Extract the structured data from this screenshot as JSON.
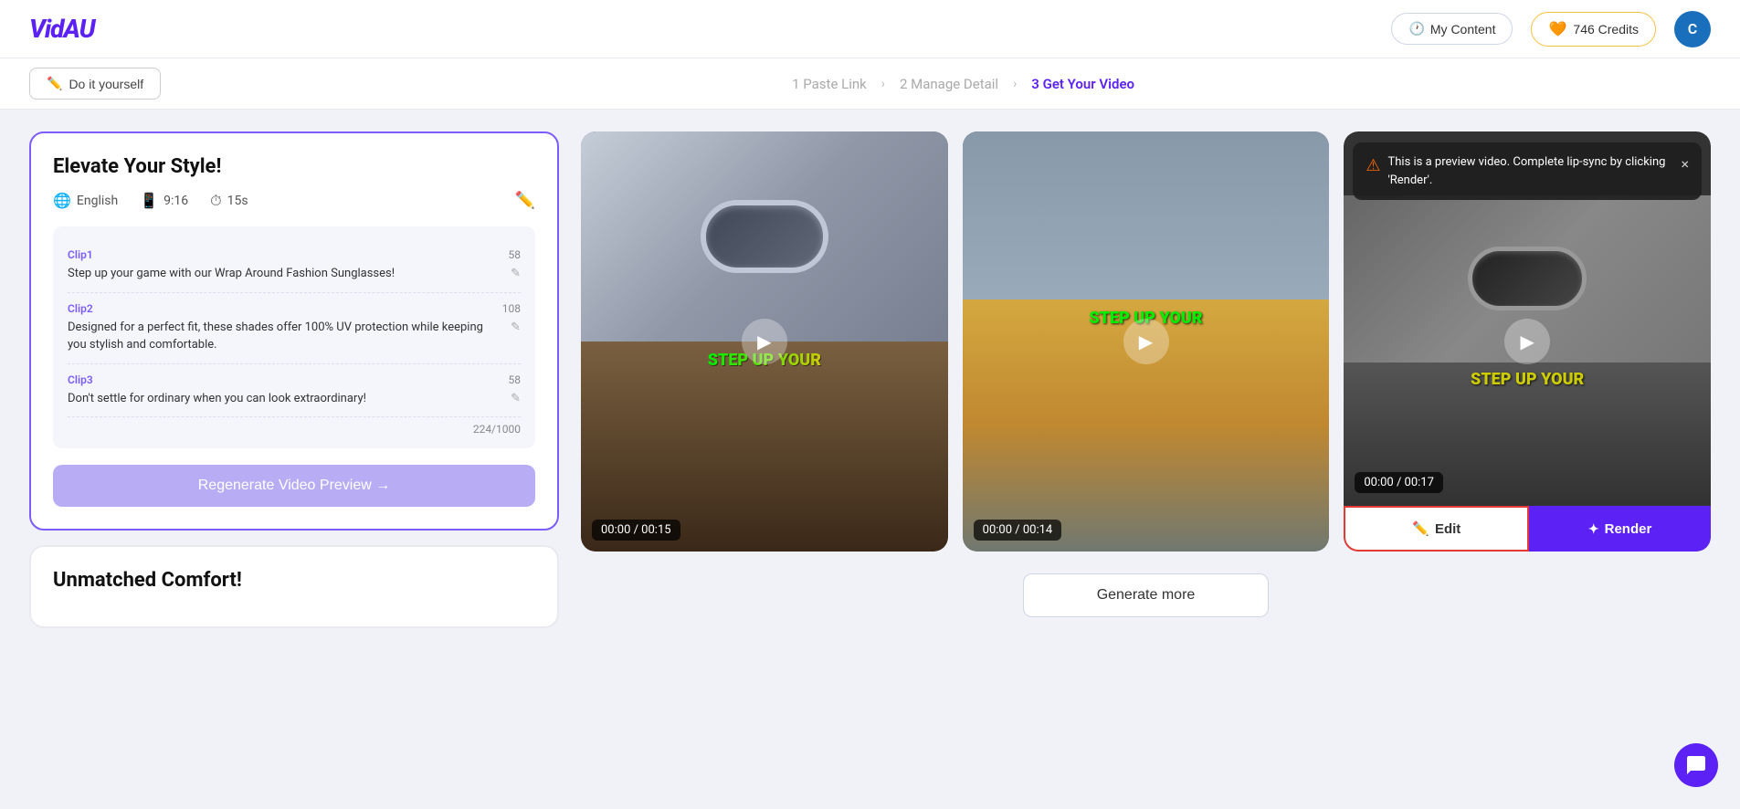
{
  "app": {
    "logo": "VidAU"
  },
  "header": {
    "my_content_label": "My Content",
    "credits_label": "746 Credits",
    "avatar_letter": "C"
  },
  "steps_nav": {
    "do_yourself_label": "Do it yourself",
    "step1_label": "1 Paste Link",
    "step2_label": "2 Manage Detail",
    "step3_label": "3 Get Your Video"
  },
  "card1": {
    "title": "Elevate Your Style!",
    "language": "English",
    "aspect": "9:16",
    "duration": "15s",
    "clips": [
      {
        "label": "Clip1",
        "count": "58",
        "text": "Step up your game with our Wrap Around Fashion Sunglasses!"
      },
      {
        "label": "Clip2",
        "count": "108",
        "text": "Designed for a perfect fit, these shades offer 100% UV protection while keeping you stylish and comfortable."
      },
      {
        "label": "Clip3",
        "count": "58",
        "text": "Don't settle for ordinary when you can look extraordinary!"
      }
    ],
    "char_count": "224/1000",
    "regen_label": "Regenerate Video Preview →"
  },
  "card2": {
    "title": "Unmatched Comfort!"
  },
  "videos": [
    {
      "timer": "00:00 / 00:15",
      "overlay_text": "STEP UP YOUR",
      "type": "person_sunglasses"
    },
    {
      "timer": "00:00 / 00:14",
      "overlay_text": "STEP UP YOUR",
      "type": "person_yellow"
    },
    {
      "timer": "00:00 / 00:17",
      "overlay_text": "STEP UP YOUR",
      "type": "preview",
      "preview_msg": "This is a preview video. Complete lip-sync by clicking 'Render'.",
      "edit_label": "Edit",
      "render_label": "Render"
    }
  ],
  "generate_more_label": "Generate more",
  "icons": {
    "clock": "🕐",
    "globe": "🌐",
    "phone": "📱",
    "edit": "✏️",
    "play": "▶",
    "star": "✦",
    "chat": "💬",
    "warning": "⚠",
    "close": "×",
    "pencil": "✎"
  },
  "colors": {
    "brand_purple": "#5b21f5",
    "accent_yellow": "#f5a623",
    "text_dark": "#111",
    "text_mid": "#555",
    "bg_light": "#f0f2f8",
    "card_border": "#7c5cfc",
    "edit_border": "#e53935"
  }
}
